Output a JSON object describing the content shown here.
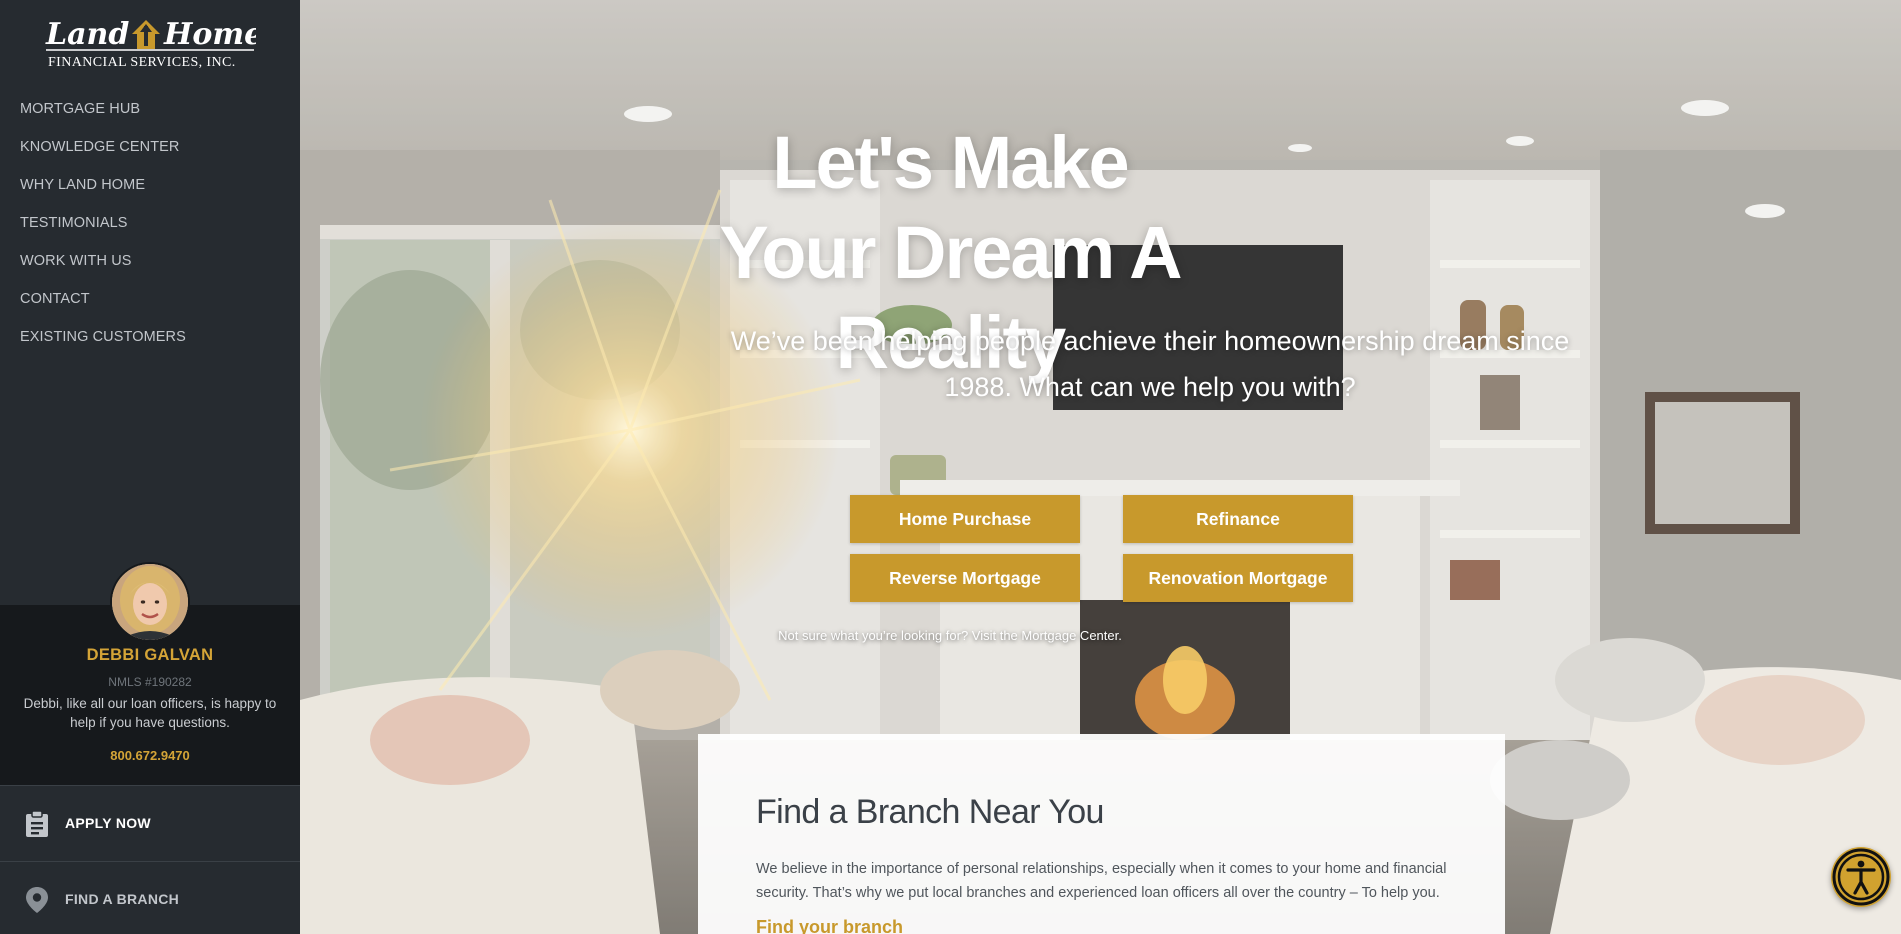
{
  "brand": {
    "logo_line1": "Land",
    "logo_line2": "Home",
    "logo_sub": "FINANCIAL SERVICES, INC.",
    "accent": "#c8992c",
    "sidebar_bg": "#262b30"
  },
  "sidebar": {
    "nav": [
      {
        "label": "MORTGAGE HUB"
      },
      {
        "label": "KNOWLEDGE CENTER"
      },
      {
        "label": "WHY LAND HOME"
      },
      {
        "label": "TESTIMONIALS"
      },
      {
        "label": "WORK WITH US"
      },
      {
        "label": "CONTACT"
      },
      {
        "label": "EXISTING CUSTOMERS"
      }
    ],
    "agent": {
      "name": "DEBBI GALVAN",
      "nmls": "NMLS #190282",
      "message": "Debbi, like all our loan officers, is happy to help if you have questions.",
      "phone": "800.672.9470"
    },
    "apply": {
      "label": "APPLY NOW",
      "icon": "clipboard-icon"
    },
    "find_branch": {
      "label": "FIND A BRANCH",
      "icon": "map-pin-icon"
    }
  },
  "hero": {
    "title": "Let's Make Your Dream A Reality",
    "subtitle": "We’ve been helping people achieve their homeownership dream since 1988. What can we help you with?",
    "buttons": {
      "purchase": "Home Purchase",
      "refinance": "Refinance",
      "reverse": "Reverse Mortgage",
      "renovation": "Renovation Mortgage"
    },
    "note": "Not sure what you’re looking for? Visit the Mortgage Center."
  },
  "branch_card": {
    "title": "Find a Branch Near You",
    "text": "We believe in the importance of personal relationships, especially when it comes to your home and financial security. That’s why we put local branches and experienced loan officers all over the country – To help you.",
    "link": "Find your branch"
  },
  "accessibility": {
    "icon": "accessibility-icon"
  }
}
